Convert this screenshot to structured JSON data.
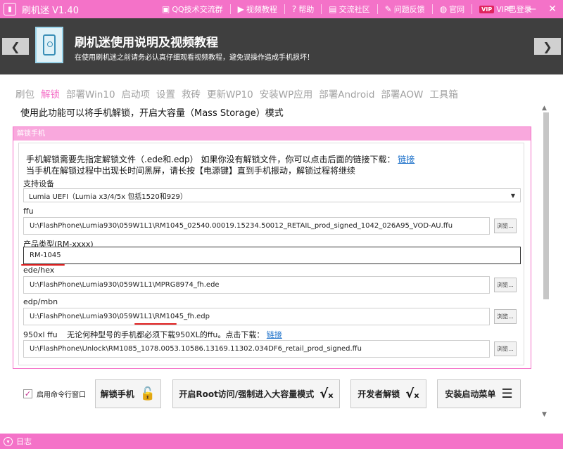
{
  "titlebar": {
    "app_title": "刷机迷 V1.40",
    "links": [
      {
        "icon": "qq-group-icon",
        "glyph": "▣",
        "label": "QQ技术交流群"
      },
      {
        "icon": "video-icon",
        "glyph": "▶",
        "label": "视频教程"
      },
      {
        "icon": "help-icon",
        "glyph": "?",
        "label": "帮助"
      },
      {
        "icon": "community-icon",
        "glyph": "▤",
        "label": "交流社区"
      },
      {
        "icon": "feedback-icon",
        "glyph": "✎",
        "label": "问题反馈"
      },
      {
        "icon": "globe-icon",
        "glyph": "◍",
        "label": "官网"
      },
      {
        "icon": "vip-icon",
        "glyph": "VIP",
        "label": "VIP已登录"
      }
    ],
    "window_buttons": {
      "menu": "≡",
      "minimize": "—",
      "close": "✕"
    }
  },
  "header": {
    "title": "刷机迷使用说明及视频教程",
    "subtitle": "在使用刷机迷之前请务必认真仔细观看视频教程，避免误操作造成手机损坏！"
  },
  "tabs": [
    "刷包",
    "解锁",
    "部署Win10",
    "启动项",
    "设置",
    "救砖",
    "更新WP10",
    "安装WP应用",
    "部署Android",
    "部署AOW",
    "工具箱"
  ],
  "active_tab": "解锁",
  "description": "使用此功能可以将手机解锁，开启大容量（Mass Storage）模式",
  "panel": {
    "title": "解锁手机",
    "note1": "手机解锁需要先指定解锁文件（.ede和.edp） 如果你没有解锁文件，你可以点击后面的链接下载：",
    "note1_link": "链接",
    "note2": "当手机在解锁过程中出现长时间黑屏，请长按【电源键】直到手机振动，解锁过程将继续",
    "device_label": "支持设备",
    "device_value": "Lumia UEFI（Lumia x3/4/5x 包括1520和929）",
    "ffu_label": "ffu",
    "ffu_value": "U:\\FlashPhone\\Lumia930\\059W1L1\\RM1045_02540.00019.15234.50012_RETAIL_prod_signed_1042_026A95_VOD-AU.ffu",
    "product_label": "产品类型(RM-xxxx)",
    "product_value": "RM-1045",
    "edehex_label": "ede/hex",
    "edehex_value": "U:\\FlashPhone\\Lumia930\\059W1L1\\MPRG8974_fh.ede",
    "edpmbn_label": "edp/mbn",
    "edpmbn_value": "U:\\FlashPhone\\Lumia930\\059W1L1\\RM1045_fh.edp",
    "ffu950_label": "950xl ffu",
    "ffu950_note": "无论何种型号的手机都必须下载950XL的ffu。点击下载：",
    "ffu950_link": "链接",
    "ffu950_value": "U:\\FlashPhone\\Unlock\\RM1085_1078.0053.10586.13169.11302.034DF6_retail_prod_signed.ffu",
    "browse_label": "浏览..."
  },
  "bottom": {
    "checkbox_label": "启用命令行窗口",
    "checkbox_checked": true,
    "unlock_button": "解锁手机",
    "root_button": "开启Root访问/强制进入大容量模式",
    "dev_unlock_button": "开发者解锁",
    "install_boot_button": "安装启动菜单"
  },
  "statusbar": {
    "label": "日志"
  }
}
